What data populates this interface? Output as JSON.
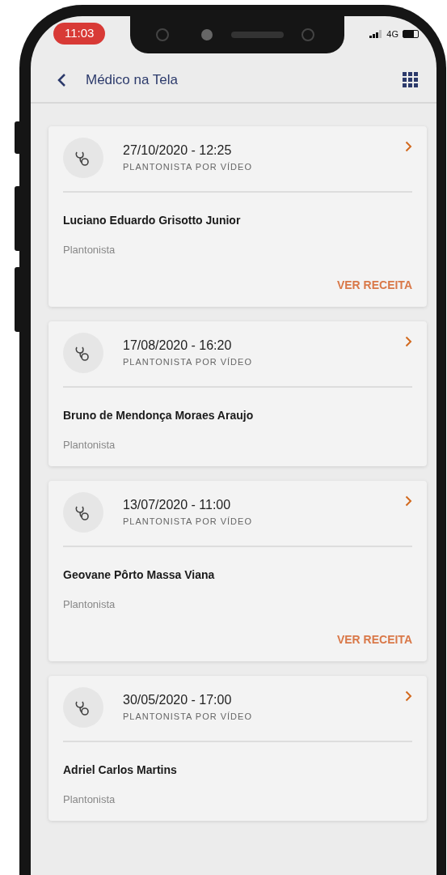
{
  "status_bar": {
    "time": "11:03",
    "network": "4G"
  },
  "header": {
    "title": "Médico na Tela"
  },
  "appointments": [
    {
      "datetime": "27/10/2020 - 12:25",
      "type": "PLANTONISTA POR VÍDEO",
      "doctor": "Luciano Eduardo Grisotto Junior",
      "role": "Plantonista",
      "action": "VER RECEITA"
    },
    {
      "datetime": "17/08/2020 - 16:20",
      "type": "PLANTONISTA POR VÍDEO",
      "doctor": "Bruno de Mendonça Moraes Araujo",
      "role": "Plantonista"
    },
    {
      "datetime": "13/07/2020 - 11:00",
      "type": "PLANTONISTA POR VÍDEO",
      "doctor": "Geovane Pôrto Massa Viana",
      "role": "Plantonista",
      "action": "VER RECEITA"
    },
    {
      "datetime": "30/05/2020 - 17:00",
      "type": "PLANTONISTA POR VÍDEO",
      "doctor": "Adriel Carlos Martins",
      "role": "Plantonista"
    }
  ]
}
